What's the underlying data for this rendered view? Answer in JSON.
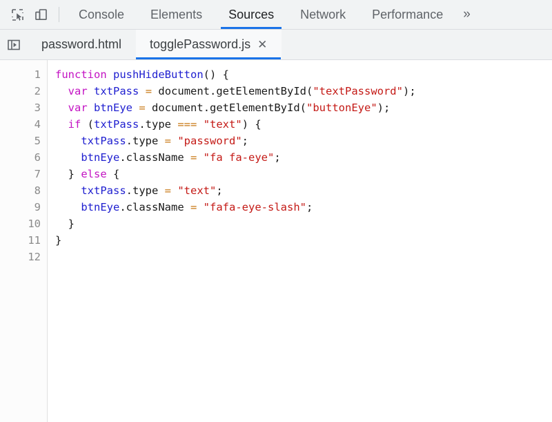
{
  "toolbar": {
    "inspect_icon": "inspect-element-icon",
    "device_icon": "device-toolbar-icon",
    "more_label": "»",
    "tabs": [
      {
        "label": "Console",
        "selected": false
      },
      {
        "label": "Elements",
        "selected": false
      },
      {
        "label": "Sources",
        "selected": true
      },
      {
        "label": "Network",
        "selected": false
      },
      {
        "label": "Performance",
        "selected": false
      }
    ]
  },
  "file_tabs": {
    "navigator_icon": "show-navigator-icon",
    "tabs": [
      {
        "label": "password.html",
        "selected": false,
        "closable": false
      },
      {
        "label": "togglePassword.js",
        "selected": true,
        "closable": true
      }
    ],
    "close_glyph": "✕"
  },
  "editor": {
    "line_numbers": [
      "1",
      "2",
      "3",
      "4",
      "5",
      "6",
      "7",
      "8",
      "9",
      "10",
      "11",
      "12"
    ],
    "lines": [
      [
        {
          "t": "function",
          "c": "t-kw"
        },
        {
          "t": " ",
          "c": "t-txt"
        },
        {
          "t": "pushHideButton",
          "c": "t-fn"
        },
        {
          "t": "() {",
          "c": "t-txt"
        }
      ],
      [
        {
          "t": "  ",
          "c": "t-txt"
        },
        {
          "t": "var",
          "c": "t-kw"
        },
        {
          "t": " ",
          "c": "t-txt"
        },
        {
          "t": "txtPass",
          "c": "t-var"
        },
        {
          "t": " ",
          "c": "t-txt"
        },
        {
          "t": "=",
          "c": "t-op"
        },
        {
          "t": " document.getElementById(",
          "c": "t-txt"
        },
        {
          "t": "\"textPassword\"",
          "c": "t-str"
        },
        {
          "t": ");",
          "c": "t-txt"
        }
      ],
      [
        {
          "t": "  ",
          "c": "t-txt"
        },
        {
          "t": "var",
          "c": "t-kw"
        },
        {
          "t": " ",
          "c": "t-txt"
        },
        {
          "t": "btnEye",
          "c": "t-var"
        },
        {
          "t": " ",
          "c": "t-txt"
        },
        {
          "t": "=",
          "c": "t-op"
        },
        {
          "t": " document.getElementById(",
          "c": "t-txt"
        },
        {
          "t": "\"buttonEye\"",
          "c": "t-str"
        },
        {
          "t": ");",
          "c": "t-txt"
        }
      ],
      [
        {
          "t": "  ",
          "c": "t-txt"
        },
        {
          "t": "if",
          "c": "t-kw"
        },
        {
          "t": " (",
          "c": "t-txt"
        },
        {
          "t": "txtPass",
          "c": "t-var"
        },
        {
          "t": ".type ",
          "c": "t-txt"
        },
        {
          "t": "===",
          "c": "t-op"
        },
        {
          "t": " ",
          "c": "t-txt"
        },
        {
          "t": "\"text\"",
          "c": "t-str"
        },
        {
          "t": ") {",
          "c": "t-txt"
        }
      ],
      [
        {
          "t": "    ",
          "c": "t-txt"
        },
        {
          "t": "txtPass",
          "c": "t-var"
        },
        {
          "t": ".type ",
          "c": "t-txt"
        },
        {
          "t": "=",
          "c": "t-op"
        },
        {
          "t": " ",
          "c": "t-txt"
        },
        {
          "t": "\"password\"",
          "c": "t-str"
        },
        {
          "t": ";",
          "c": "t-txt"
        }
      ],
      [
        {
          "t": "    ",
          "c": "t-txt"
        },
        {
          "t": "btnEye",
          "c": "t-var"
        },
        {
          "t": ".className ",
          "c": "t-txt"
        },
        {
          "t": "=",
          "c": "t-op"
        },
        {
          "t": " ",
          "c": "t-txt"
        },
        {
          "t": "\"fa fa-eye\"",
          "c": "t-str"
        },
        {
          "t": ";",
          "c": "t-txt"
        }
      ],
      [
        {
          "t": "  } ",
          "c": "t-txt"
        },
        {
          "t": "else",
          "c": "t-kw"
        },
        {
          "t": " {",
          "c": "t-txt"
        }
      ],
      [
        {
          "t": "    ",
          "c": "t-txt"
        },
        {
          "t": "txtPass",
          "c": "t-var"
        },
        {
          "t": ".type ",
          "c": "t-txt"
        },
        {
          "t": "=",
          "c": "t-op"
        },
        {
          "t": " ",
          "c": "t-txt"
        },
        {
          "t": "\"text\"",
          "c": "t-str"
        },
        {
          "t": ";",
          "c": "t-txt"
        }
      ],
      [
        {
          "t": "    ",
          "c": "t-txt"
        },
        {
          "t": "btnEye",
          "c": "t-var"
        },
        {
          "t": ".className ",
          "c": "t-txt"
        },
        {
          "t": "=",
          "c": "t-op"
        },
        {
          "t": " ",
          "c": "t-txt"
        },
        {
          "t": "\"fafa-eye-slash\"",
          "c": "t-str"
        },
        {
          "t": ";",
          "c": "t-txt"
        }
      ],
      [
        {
          "t": "  }",
          "c": "t-txt"
        }
      ],
      [
        {
          "t": "}",
          "c": "t-txt"
        }
      ],
      []
    ]
  },
  "colors": {
    "accent": "#1a73e8",
    "toolbar_bg": "#f1f3f4",
    "editor_bg": "#ffffff",
    "keyword": "#c313c3",
    "identifier": "#2020d0",
    "string": "#c41a16",
    "operator": "#c87814",
    "text": "#1a1a1a"
  }
}
